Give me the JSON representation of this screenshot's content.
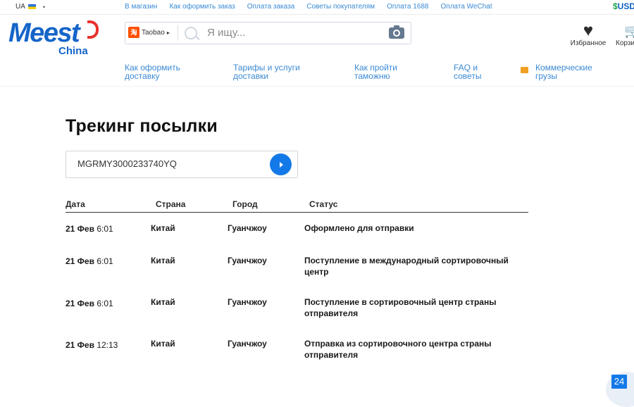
{
  "topbar": {
    "lang": "UA",
    "links": [
      "В магазин",
      "Как оформить заказ",
      "Оплата заказа",
      "Советы покупателям",
      "Оплата 1688",
      "Оплата WeChat"
    ],
    "currency_symbol": "$",
    "currency": "USD"
  },
  "logo": {
    "main": "Meest",
    "sub": "China"
  },
  "search": {
    "source": "Taobao",
    "source_badge": "淘",
    "placeholder": "Я ищу..."
  },
  "header": {
    "favorites_label": "Избранное",
    "cart_label": "Корзина"
  },
  "nav": [
    {
      "line1": "Как оформить",
      "line2": "доставку"
    },
    {
      "line1": "Тарифы и услуги",
      "line2": "доставки"
    },
    {
      "line1": "Как пройти",
      "line2": "таможню"
    },
    {
      "line1": "FAQ и",
      "line2": "советы"
    },
    {
      "line1": "Коммерческие",
      "line2": "грузы"
    }
  ],
  "page": {
    "title": "Трекинг посылки",
    "tracking_value": "MGRMY3000233740YQ"
  },
  "table": {
    "headers": [
      "Дата",
      "Страна",
      "Город",
      "Статус"
    ],
    "rows": [
      {
        "date": "21 Фев",
        "time": "6:01",
        "country": "Китай",
        "city": "Гуанчжоу",
        "status": "Оформлено для отправки"
      },
      {
        "date": "21 Фев",
        "time": "6:01",
        "country": "Китай",
        "city": "Гуанчжоу",
        "status": "Поступление в международный сортировочный центр"
      },
      {
        "date": "21 Фев",
        "time": "6:01",
        "country": "Китай",
        "city": "Гуанчжоу",
        "status": "Поступление в сортировочный центр страны отправителя"
      },
      {
        "date": "21 Фев",
        "time": "12:13",
        "country": "Китай",
        "city": "Гуанчжоу",
        "status": "Отправка из сортировочного центра страны отправителя"
      }
    ]
  },
  "widget": {
    "label": "24"
  },
  "colors": {
    "brand": "#1565c9",
    "accent": "#1479e8",
    "link": "#3a8ad4",
    "currency_sign": "#1ba44a"
  }
}
